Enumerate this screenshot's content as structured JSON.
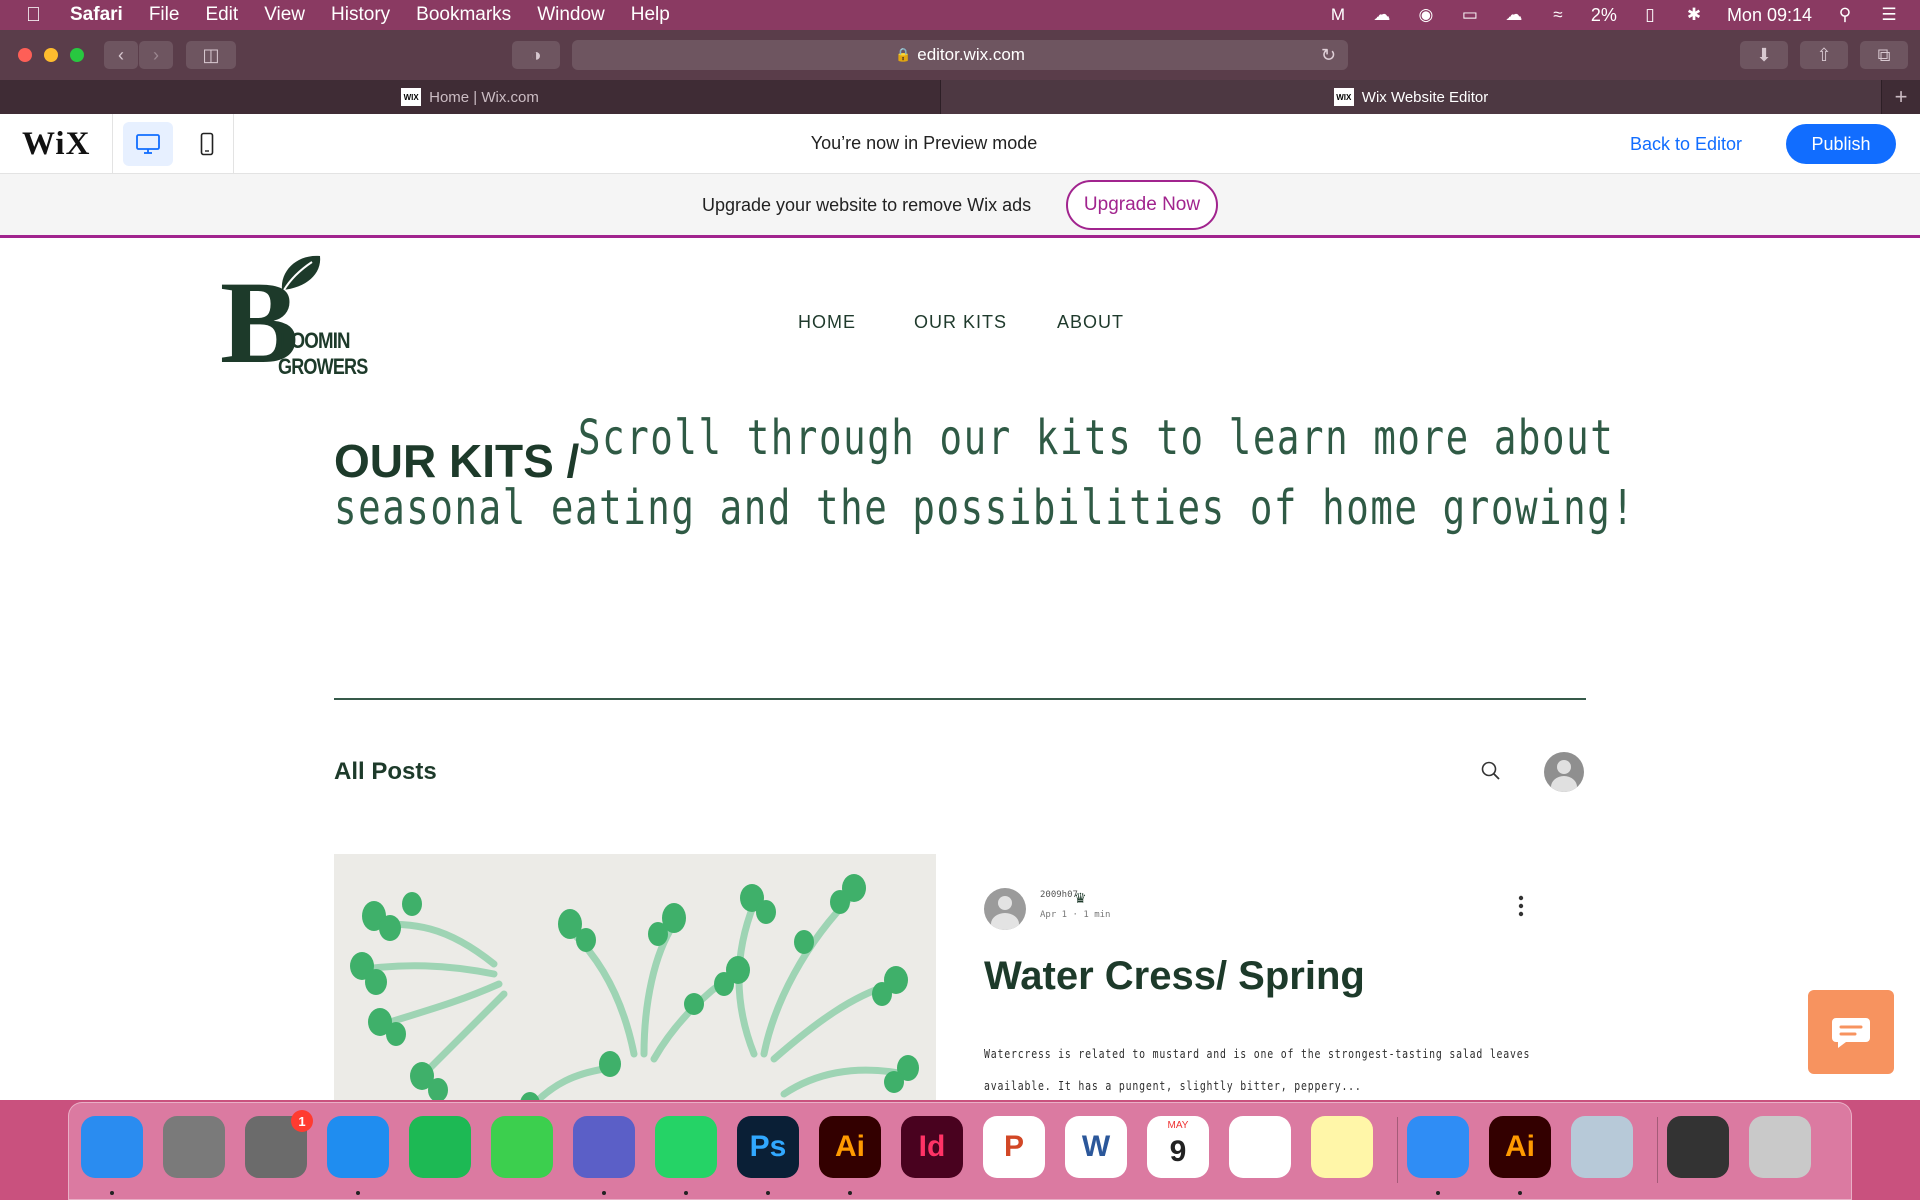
{
  "menubar": {
    "app": "Safari",
    "items": [
      "File",
      "Edit",
      "View",
      "History",
      "Bookmarks",
      "Window",
      "Help"
    ],
    "battery": "2%",
    "clock": "Mon 09:14"
  },
  "browser": {
    "url": "editor.wix.com",
    "tabs": [
      {
        "favicon": "WIX",
        "label": "Home | Wix.com"
      },
      {
        "favicon": "WIX",
        "label": "Wix Website Editor"
      }
    ]
  },
  "wixbar": {
    "logo": "WiX",
    "preview_text": "You’re now in Preview mode",
    "back_label": "Back to Editor",
    "publish_label": "Publish"
  },
  "upgrade": {
    "text": "Upgrade your website to remove Wix ads",
    "button": "Upgrade Now"
  },
  "site": {
    "logo": {
      "initial": "B",
      "line1": "LOOMIN",
      "line2": "GROWERS"
    },
    "nav": [
      "HOME",
      "OUR KITS",
      "ABOUT"
    ],
    "hero": {
      "title": "OUR KITS /",
      "line1": "Scroll through our kits to learn more about",
      "line2": "seasonal eating and the possibilities of home growing!"
    },
    "blog": {
      "section_title": "All Posts",
      "post": {
        "author": "2009h07",
        "date": "Apr 1",
        "read_time": "1 min",
        "title": "Water Cress/ Spring",
        "excerpt_line1": "Watercress is related to mustard and is one of the strongest-tasting salad leaves",
        "excerpt_line2": "available. It has a pungent, slightly bitter, peppery..."
      }
    }
  },
  "dock": {
    "items": [
      {
        "name": "finder",
        "label": "",
        "bg": "#2a8cf0"
      },
      {
        "name": "launchpad",
        "label": "",
        "bg": "#7a7a7a"
      },
      {
        "name": "system-preferences",
        "label": "",
        "bg": "#6b6b6b",
        "badge": "1"
      },
      {
        "name": "safari",
        "label": "",
        "bg": "#1f8df0"
      },
      {
        "name": "spotify",
        "label": "",
        "bg": "#1db954"
      },
      {
        "name": "facetime",
        "label": "",
        "bg": "#3ccf4e"
      },
      {
        "name": "teams",
        "label": "",
        "bg": "#5b5fc7"
      },
      {
        "name": "whatsapp",
        "label": "",
        "bg": "#25d366"
      },
      {
        "name": "photoshop",
        "label": "Ps",
        "bg": "#0a1f36",
        "fg": "#31a8ff"
      },
      {
        "name": "illustrator",
        "label": "Ai",
        "bg": "#330000",
        "fg": "#ff9a00"
      },
      {
        "name": "indesign",
        "label": "Id",
        "bg": "#49021f",
        "fg": "#ff3366"
      },
      {
        "name": "powerpoint",
        "label": "P",
        "bg": "#ffffff",
        "fg": "#d24726"
      },
      {
        "name": "word",
        "label": "W",
        "bg": "#ffffff",
        "fg": "#2b579a"
      },
      {
        "name": "calendar",
        "label": "9",
        "bg": "#ffffff",
        "fg": "#222222",
        "month": "MAY"
      },
      {
        "name": "reminders",
        "label": "",
        "bg": "#ffffff"
      },
      {
        "name": "notes",
        "label": "",
        "bg": "#fff6a8"
      },
      {
        "name": "mail-app",
        "label": "",
        "bg": "#2f8df5"
      },
      {
        "name": "illustrator-2",
        "label": "Ai",
        "bg": "#330000",
        "fg": "#ff9a00"
      },
      {
        "name": "preview",
        "label": "",
        "bg": "#b7c9d8"
      },
      {
        "name": "stacks",
        "label": "",
        "bg": "#333333"
      },
      {
        "name": "trash",
        "label": "",
        "bg": "#c9c9c9"
      }
    ]
  }
}
